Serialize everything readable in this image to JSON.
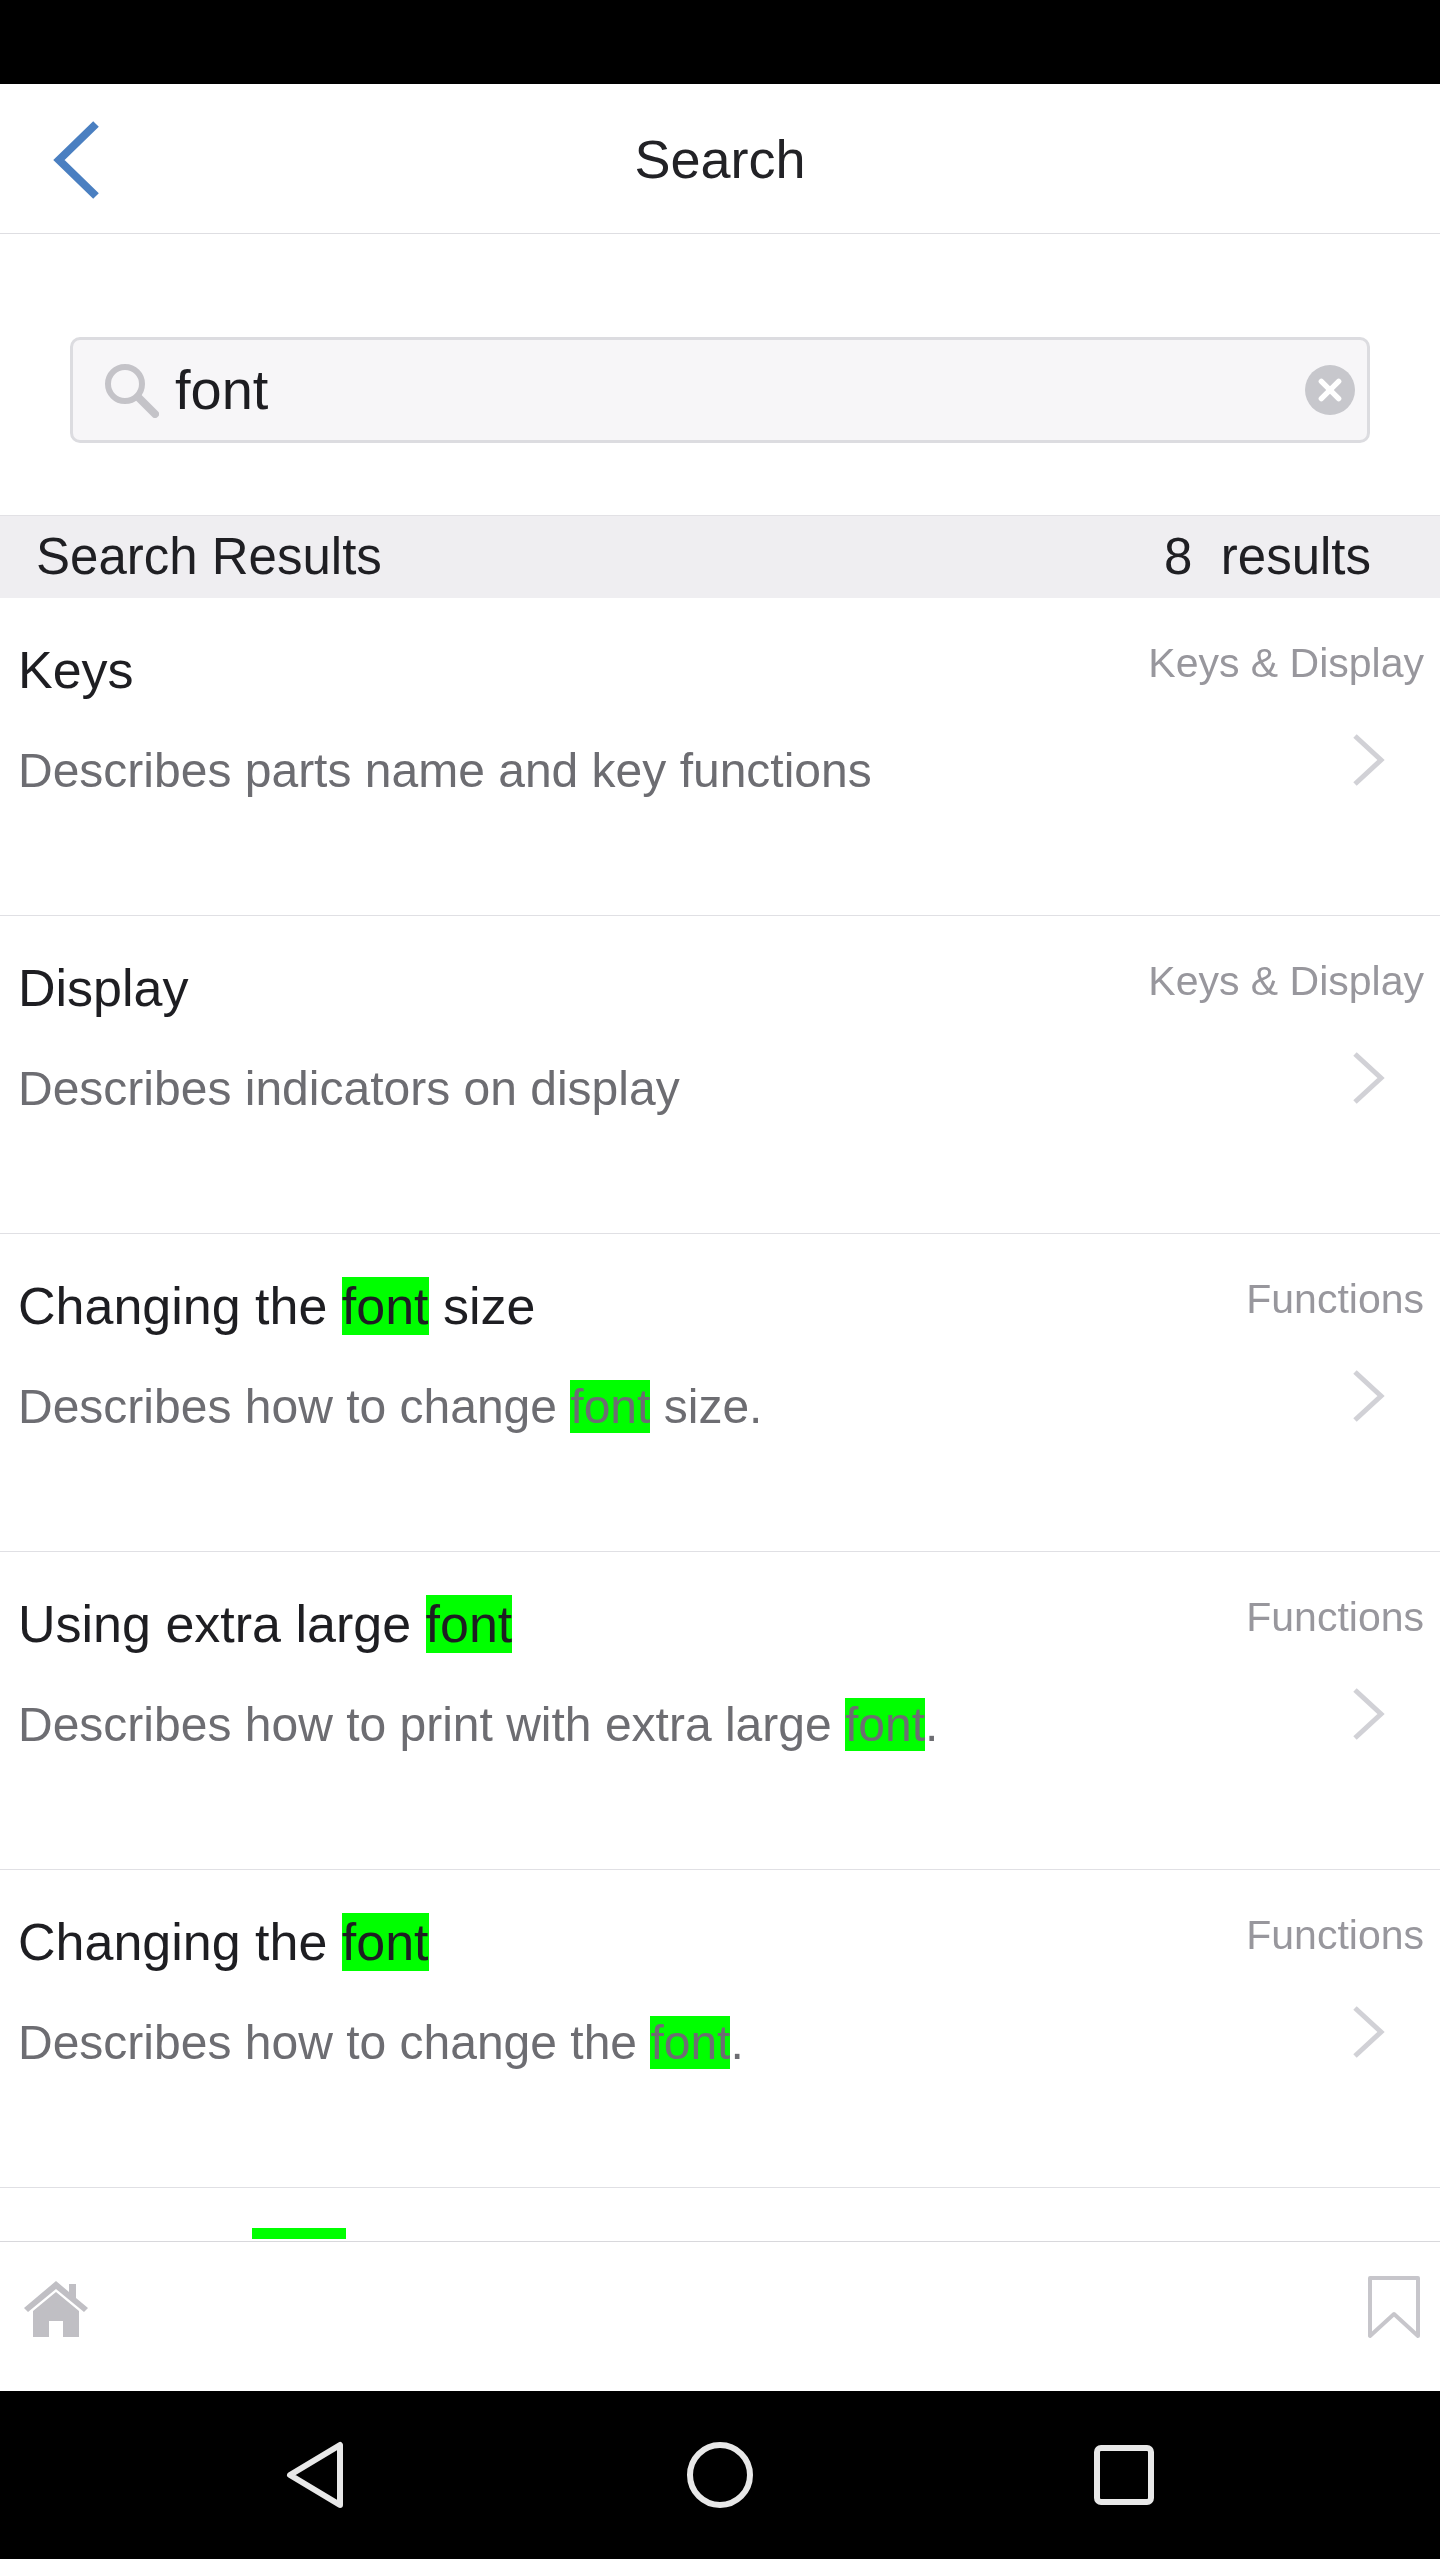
{
  "header": {
    "title": "Search"
  },
  "search": {
    "value": "font"
  },
  "results_header": {
    "label": "Search Results",
    "count": "8  results"
  },
  "results": [
    {
      "title": [
        {
          "text": "Keys",
          "highlighted": false
        }
      ],
      "category": "Keys & Display",
      "description": [
        {
          "text": "Describes parts name and key functions",
          "highlighted": false
        }
      ]
    },
    {
      "title": [
        {
          "text": "Display",
          "highlighted": false
        }
      ],
      "category": "Keys & Display",
      "description": [
        {
          "text": "Describes indicators on display",
          "highlighted": false
        }
      ]
    },
    {
      "title": [
        {
          "text": "Changing the ",
          "highlighted": false
        },
        {
          "text": "font",
          "highlighted": true
        },
        {
          "text": " size",
          "highlighted": false
        }
      ],
      "category": "Functions",
      "description": [
        {
          "text": "Describes how to change ",
          "highlighted": false
        },
        {
          "text": "font",
          "highlighted": true
        },
        {
          "text": " size.",
          "highlighted": false
        }
      ]
    },
    {
      "title": [
        {
          "text": "Using extra large ",
          "highlighted": false
        },
        {
          "text": "font",
          "highlighted": true
        }
      ],
      "category": "Functions",
      "description": [
        {
          "text": "Describes how to print with extra large ",
          "highlighted": false
        },
        {
          "text": "font",
          "highlighted": true
        },
        {
          "text": ".",
          "highlighted": false
        }
      ]
    },
    {
      "title": [
        {
          "text": "Changing the ",
          "highlighted": false
        },
        {
          "text": "font",
          "highlighted": true
        }
      ],
      "category": "Functions",
      "description": [
        {
          "text": "Describes how to change the ",
          "highlighted": false
        },
        {
          "text": "font",
          "highlighted": true
        },
        {
          "text": ".",
          "highlighted": false
        }
      ]
    }
  ],
  "cut_off_row": {
    "highlighted": true
  }
}
